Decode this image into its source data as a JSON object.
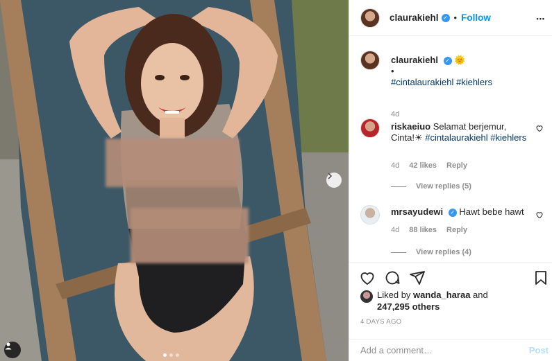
{
  "post": {
    "author": "claurakiehl",
    "follow_label": "Follow",
    "separator": "•",
    "more_label": "•••"
  },
  "caption": {
    "author": "claurakiehl",
    "emoji": "🌞",
    "bullet": "•",
    "hashtags": [
      "#cintalaurakiehl",
      "#kiehlers"
    ],
    "age": "4d"
  },
  "comments": [
    {
      "author": "riskaeiuo",
      "text": "Selamat berjemur, Cinta!☀",
      "hashtags": [
        "#cintalaurakiehl",
        "#kiehlers"
      ],
      "age": "4d",
      "likes": "42 likes",
      "reply_label": "Reply",
      "view_replies": "View replies (5)"
    },
    {
      "author": "mrsayudewi",
      "text": "Hawt bebe hawt",
      "age": "4d",
      "likes": "88 likes",
      "reply_label": "Reply",
      "view_replies": "View replies (4)"
    }
  ],
  "likes": {
    "prefix": "Liked by",
    "user": "wanda_haraa",
    "and": "and",
    "count": "247,295 others"
  },
  "timestamp": "4 DAYS AGO",
  "add_comment": {
    "placeholder": "Add a comment…",
    "post_label": "Post"
  },
  "colors": {
    "accent": "#0095f6",
    "verified": "#3897f0",
    "hashtag": "#00376b",
    "muted": "#8e8e8e"
  },
  "carousel": {
    "slides": 3,
    "active_index": 0
  }
}
